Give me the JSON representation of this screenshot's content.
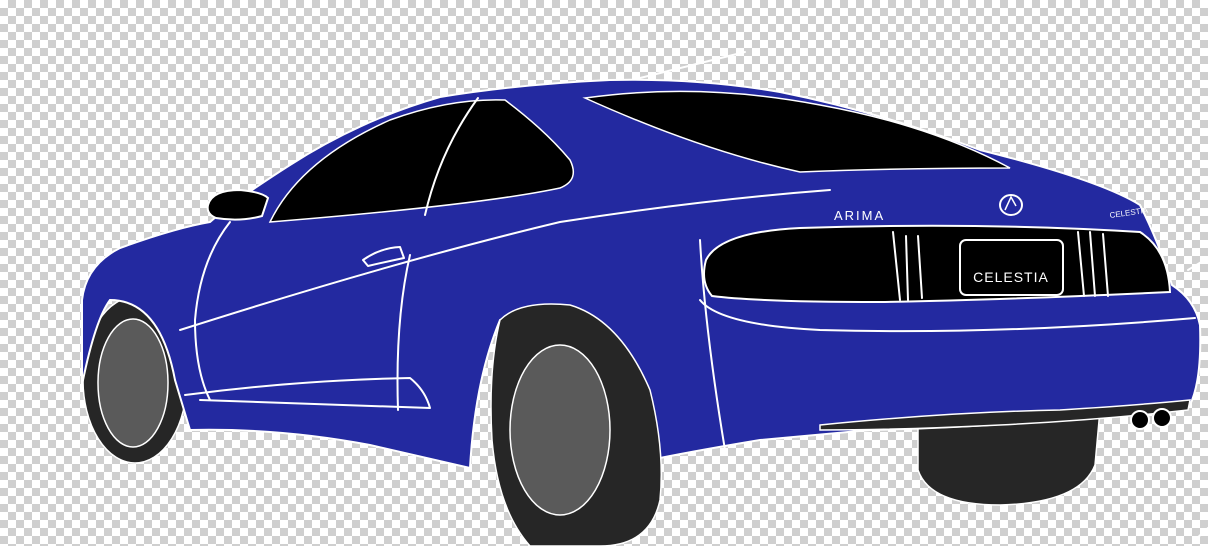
{
  "drawing": {
    "badge_left": "ARIMA",
    "badge_right": "CELESTIA",
    "plate_text": "CELESTIA",
    "colors": {
      "body": "#2329a0",
      "glass": "#000000",
      "tire": "#262626",
      "wheel": "#5a5a5a",
      "line": "#ffffff",
      "checker_light": "#ffffff",
      "checker_dark": "#cfcfcf"
    }
  }
}
